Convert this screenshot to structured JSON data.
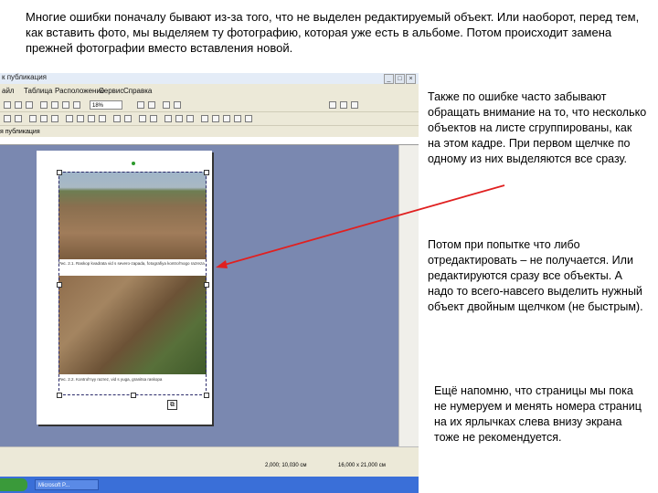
{
  "intro_text": "Многие ошибки поначалу бывают из-за того, что не выделен редактируемый объект. Или наоборот, перед тем, как вставить фото, мы выделяем ту фотографию, которая уже есть в альбоме. Потом происходит замена прежней фотографии вместо вставления новой.",
  "app": {
    "title": "к публикация",
    "menu": [
      "айл",
      "Таблица",
      "Расположение",
      "Сервис",
      "Справка"
    ],
    "font_size": "18%",
    "pane_title": "я публикация",
    "caption1": "Рис. 2.1. Raskop kvadrata vid s severo-zapada, fotografiya kontrol'nogo razreza",
    "caption2": "Рис. 2.2. Kontrol'nyy razrez, vid s yuga, granitsa raskopa",
    "status_left": "2,000; 10,030 см",
    "status_right": "16,000 x 21,000 см",
    "task_label": "Microsoft P..."
  },
  "notes": {
    "note1": "Также по ошибке часто забывают обращать внимание на то, что несколько объектов на листе сгруппированы, как на этом кадре. При первом щелчке по одному из них выделяются все сразу.",
    "note2": "Потом при попытке что либо отредактировать – не получается. Или редактируются сразу все объекты. А надо то всего-навсего выделить нужный объект двойным щелчком (не быстрым).",
    "note3": "Ещё напомню, что страницы мы пока не нумеруем и менять номера страниц на их ярлычках слева внизу экрана тоже не рекомендуется."
  },
  "colors": {
    "arrow": "#e02020",
    "workspace": "#7a88b0",
    "page": "#ffffff"
  }
}
